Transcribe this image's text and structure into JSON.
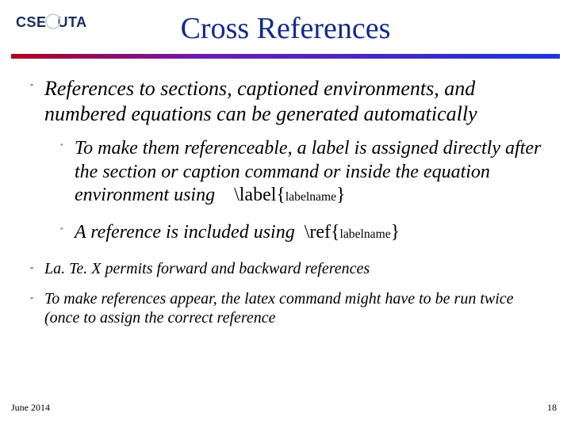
{
  "logo": {
    "left": "CSE",
    "right": "UTA"
  },
  "title": "Cross References",
  "bullets": {
    "b1": "References to sections, captioned environments, and numbered equations can be generated automatically",
    "s1_prefix": "To make them referenceable, a label is assigned directly after the section or caption command or inside the equation environment using",
    "s1_cmd": "\\label{",
    "s1_arg": "labelname",
    "s1_close": "}",
    "s2_prefix": "A reference is included using",
    "s2_cmd": "\\ref{",
    "s2_arg": "labelname",
    "s2_close": "}",
    "b2": "La. Te. X permits forward and backward references",
    "b3": "To make references appear, the latex command might have to be run twice (once to assign the correct reference"
  },
  "footer": {
    "date": "June 2014",
    "page": "18"
  },
  "marks": {
    "b": "\""
  }
}
